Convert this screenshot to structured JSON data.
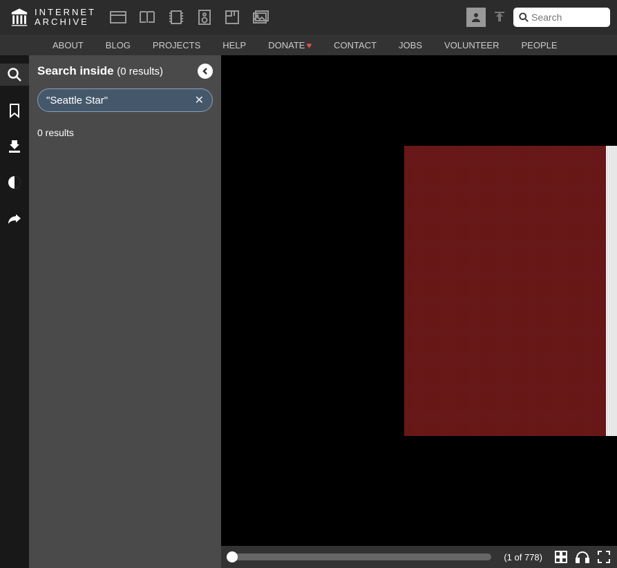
{
  "logo": {
    "line1": "INTERNET",
    "line2": "ARCHIVE"
  },
  "search": {
    "placeholder": "Search",
    "value": ""
  },
  "nav": {
    "about": "ABOUT",
    "blog": "BLOG",
    "projects": "PROJECTS",
    "help": "HELP",
    "donate": "DONATE",
    "contact": "CONTACT",
    "jobs": "JOBS",
    "volunteer": "VOLUNTEER",
    "people": "PEOPLE"
  },
  "panel": {
    "title": "Search inside",
    "title_count": "(0 results)",
    "chip": "\"Seattle Star\"",
    "results_line": "0 results"
  },
  "footer": {
    "page_label": "(1 of 778)"
  }
}
